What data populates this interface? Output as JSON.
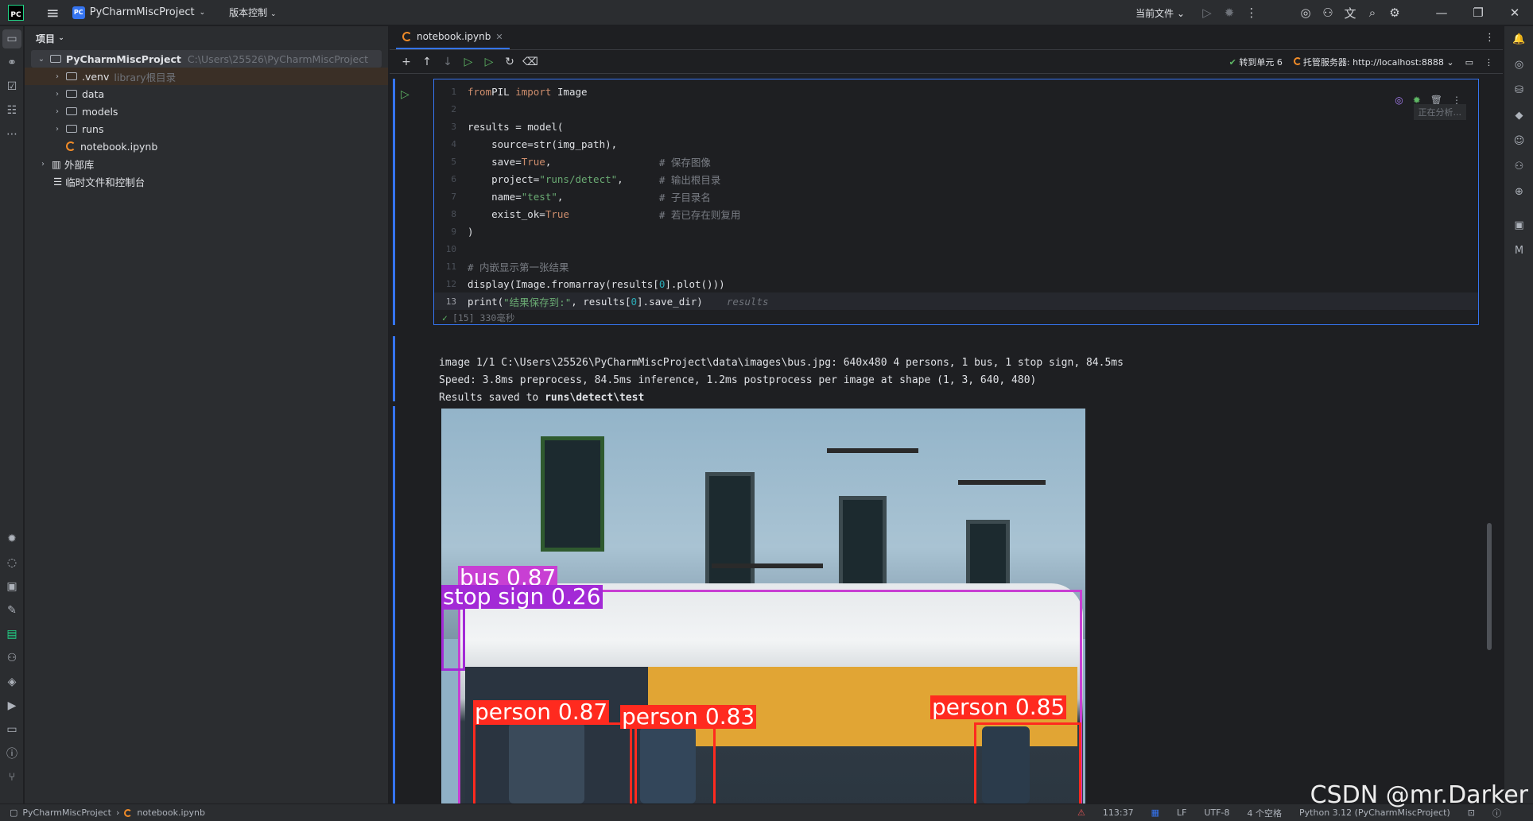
{
  "topbar": {
    "logo": "PC",
    "project_badge": "PC",
    "project_name": "PyCharmMiscProject",
    "vcs": "版本控制",
    "current_file": "当前文件"
  },
  "project_panel": {
    "title": "项目",
    "root_name": "PyCharmMiscProject",
    "root_path": "C:\\Users\\25526\\PyCharmMiscProject",
    "items": [
      {
        "name": ".venv",
        "hint": "library根目录"
      },
      {
        "name": "data"
      },
      {
        "name": "models"
      },
      {
        "name": "runs"
      },
      {
        "name": "notebook.ipynb"
      }
    ],
    "external_libs": "外部库",
    "scratches": "临时文件和控制台"
  },
  "editor": {
    "tab_name": "notebook.ipynb",
    "goto_cell": "转到单元 6",
    "server": "托管服务器: http://localhost:8888",
    "analyzing": "正在分析...",
    "code_lines": [
      {
        "n": "1",
        "segs": [
          [
            "kw",
            "from"
          ],
          [
            "",
            "PIL "
          ],
          [
            "kw",
            "import"
          ],
          [
            "",
            " Image"
          ]
        ]
      },
      {
        "n": "2",
        "segs": []
      },
      {
        "n": "3",
        "segs": [
          [
            "",
            "results = model("
          ]
        ]
      },
      {
        "n": "4",
        "segs": [
          [
            "",
            "    source=str(img_path),"
          ]
        ]
      },
      {
        "n": "5",
        "segs": [
          [
            "",
            "    save="
          ],
          [
            "kw",
            "True"
          ],
          [
            "",
            ",                  "
          ],
          [
            "cm",
            "# 保存图像"
          ]
        ]
      },
      {
        "n": "6",
        "segs": [
          [
            "",
            "    project="
          ],
          [
            "str",
            "\"runs/detect\""
          ],
          [
            "",
            ",      "
          ],
          [
            "cm",
            "# 输出根目录"
          ]
        ]
      },
      {
        "n": "7",
        "segs": [
          [
            "",
            "    name="
          ],
          [
            "str",
            "\"test\""
          ],
          [
            "",
            ",                "
          ],
          [
            "cm",
            "# 子目录名"
          ]
        ]
      },
      {
        "n": "8",
        "segs": [
          [
            "",
            "    exist_ok="
          ],
          [
            "kw",
            "True"
          ],
          [
            "",
            "               "
          ],
          [
            "cm",
            "# 若已存在则复用"
          ]
        ]
      },
      {
        "n": "9",
        "segs": [
          [
            "",
            ")"
          ]
        ]
      },
      {
        "n": "10",
        "segs": []
      },
      {
        "n": "11",
        "segs": [
          [
            "cm",
            "# 内嵌显示第一张结果"
          ]
        ]
      },
      {
        "n": "12",
        "segs": [
          [
            "",
            "display(Image.fromarray(results["
          ],
          [
            "num",
            "0"
          ],
          [
            "",
            "].plot()))"
          ]
        ]
      },
      {
        "n": "13",
        "segs": [
          [
            "",
            "print("
          ],
          [
            "str",
            "\"结果保存到:\""
          ],
          [
            "",
            ", results["
          ],
          [
            "num",
            "0"
          ],
          [
            "",
            "].save_dir)"
          ]
        ],
        "hint": "results"
      }
    ],
    "exec_status": "[15] 330毫秒",
    "output_lines": [
      "image 1/1 C:\\Users\\25526\\PyCharmMiscProject\\data\\images\\bus.jpg: 640x480 4 persons, 1 bus, 1 stop sign, 84.5ms",
      "Speed: 3.8ms preprocess, 84.5ms inference, 1.2ms postprocess per image at shape (1, 3, 640, 480)"
    ],
    "output_saved_prefix": "Results saved to ",
    "output_saved_path": "runs\\detect\\test",
    "detections": [
      {
        "label": "bus 0.87",
        "color": "#c83fd3"
      },
      {
        "label": "stop sign 0.26",
        "color": "#a32ad6"
      },
      {
        "label": "person 0.87",
        "color": "#ff2a1f"
      },
      {
        "label": "person 0.83",
        "color": "#ff2a1f"
      },
      {
        "label": "person 0.85",
        "color": "#ff2a1f"
      }
    ]
  },
  "statusbar": {
    "crumb_project": "PyCharmMiscProject",
    "crumb_file": "notebook.ipynb",
    "position": "113:37",
    "line_sep": "LF",
    "encoding": "UTF-8",
    "indent": "4 个空格",
    "interpreter": "Python 3.12 (PyCharmMiscProject)"
  },
  "watermark": "CSDN @mr.Darker"
}
